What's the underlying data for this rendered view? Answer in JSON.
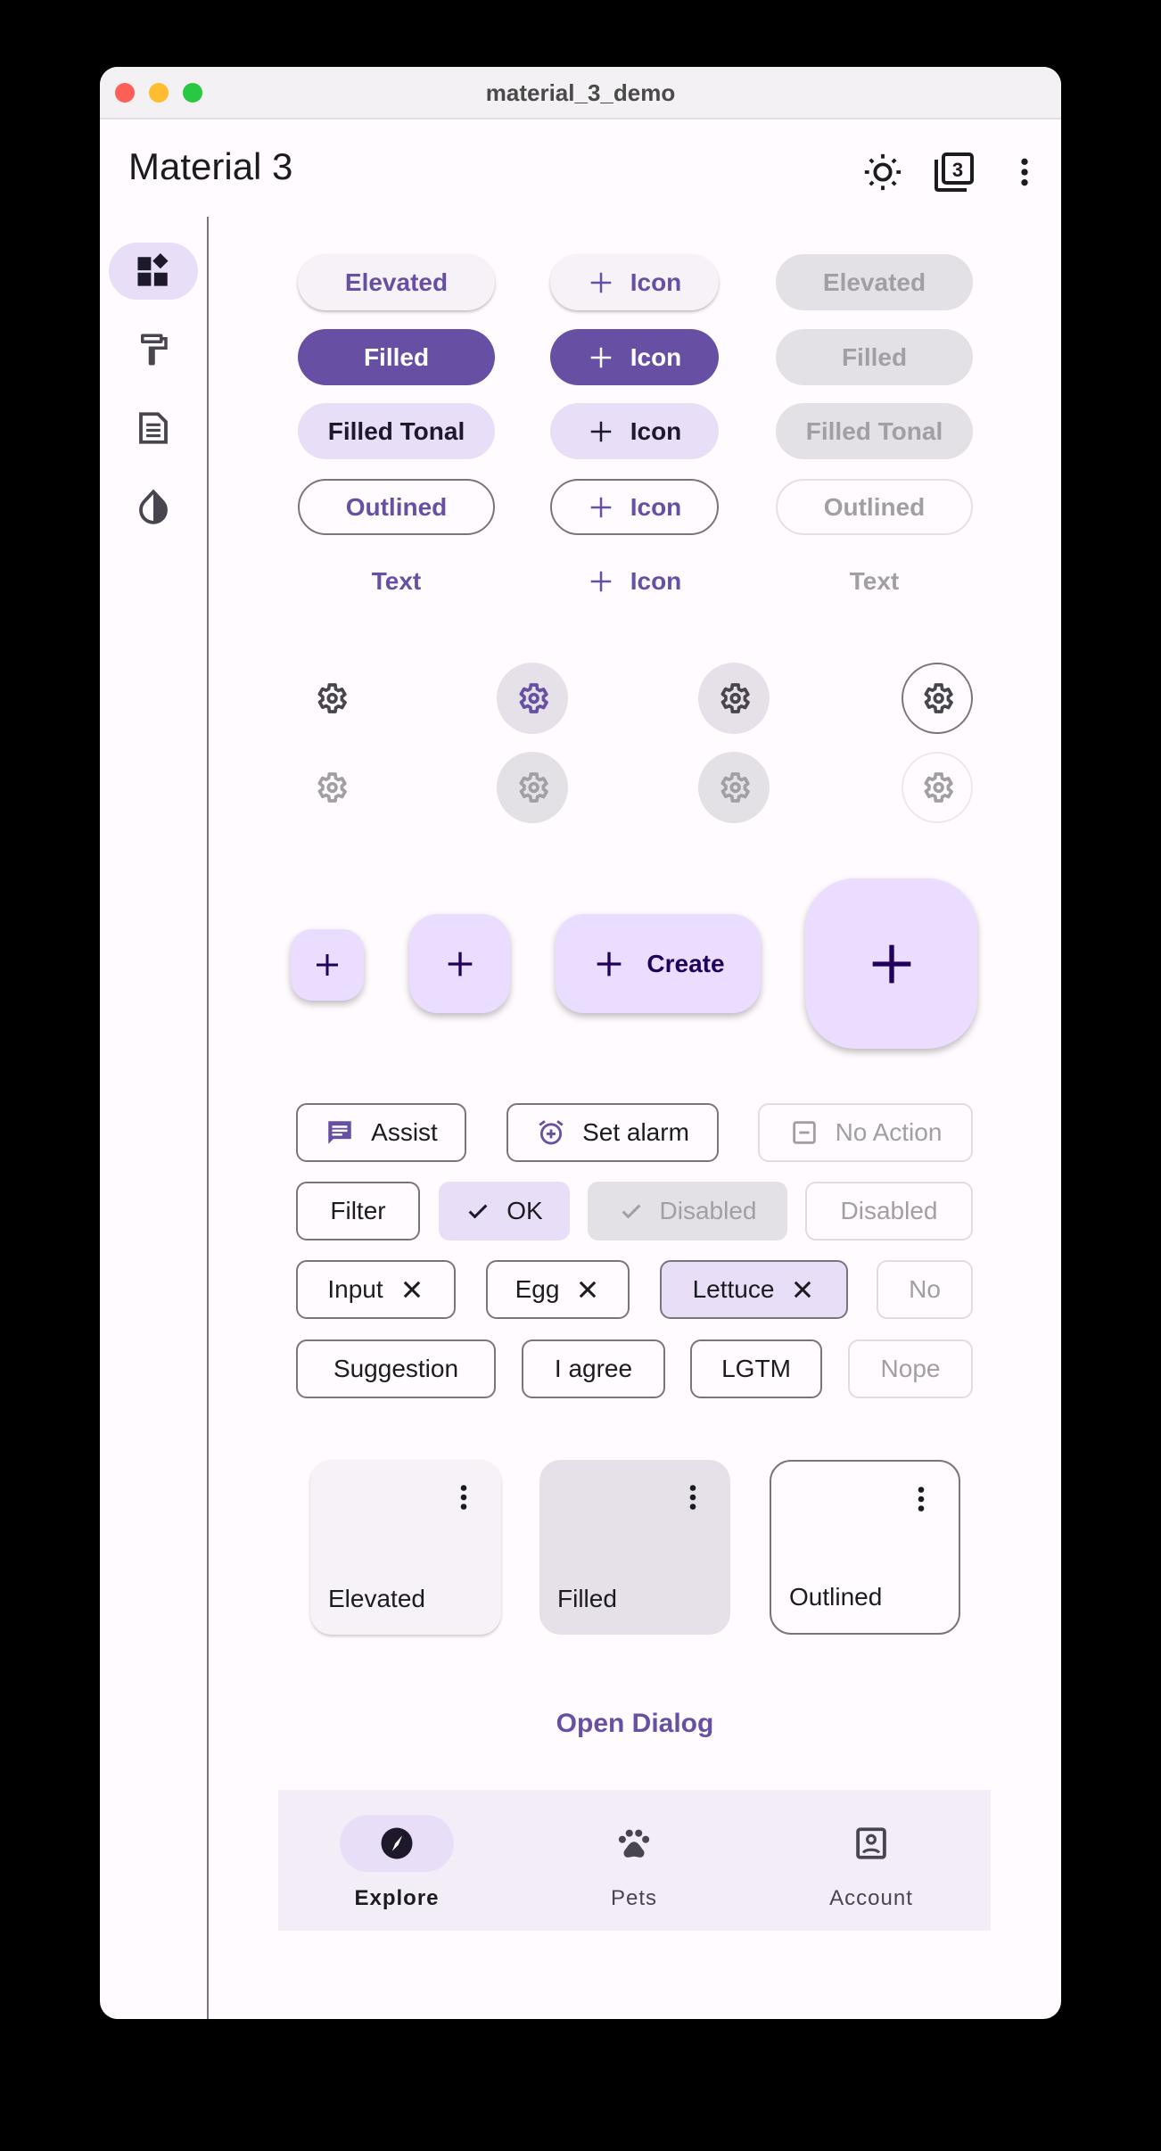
{
  "window": {
    "title": "material_3_demo"
  },
  "appbar": {
    "title": "Material 3",
    "actions": [
      {
        "icon": "brightness-icon",
        "name": "toggle-brightness"
      },
      {
        "icon": "filter-3-icon",
        "name": "material-version"
      },
      {
        "icon": "more-vert-icon",
        "name": "more-options"
      }
    ]
  },
  "rail": {
    "items": [
      {
        "icon": "widgets-icon",
        "name": "components",
        "selected": true
      },
      {
        "icon": "format-paint-icon",
        "name": "color",
        "selected": false
      },
      {
        "icon": "article-icon",
        "name": "typography",
        "selected": false
      },
      {
        "icon": "invert-colors-icon",
        "name": "elevation",
        "selected": false
      }
    ]
  },
  "buttons": {
    "enabled": [
      "Elevated",
      "Filled",
      "Filled Tonal",
      "Outlined",
      "Text"
    ],
    "icon_label": "Icon",
    "disabled": [
      "Elevated",
      "Filled",
      "Filled Tonal",
      "Outlined",
      "Text"
    ]
  },
  "icon_buttons": {
    "rows": [
      "enabled",
      "disabled"
    ],
    "styles": [
      "standard",
      "filled",
      "filled-tonal",
      "outlined"
    ],
    "icon": "settings-icon"
  },
  "fabs": {
    "extended_label": "Create",
    "sizes": [
      "small",
      "regular",
      "extended",
      "large"
    ]
  },
  "chips": {
    "assist": [
      "Assist",
      "Set alarm",
      "No Action"
    ],
    "filter": [
      "Filter",
      "OK",
      "Disabled",
      "Disabled"
    ],
    "input": [
      "Input",
      "Egg",
      "Lettuce",
      "No"
    ],
    "suggestion": [
      "Suggestion",
      "I agree",
      "LGTM",
      "Nope"
    ]
  },
  "cards": [
    "Elevated",
    "Filled",
    "Outlined"
  ],
  "dialog": {
    "open_label": "Open Dialog"
  },
  "bottom_nav": {
    "items": [
      {
        "label": "Explore",
        "icon": "explore-icon",
        "selected": true
      },
      {
        "label": "Pets",
        "icon": "pets-icon",
        "selected": false
      },
      {
        "label": "Account",
        "icon": "account-box-icon",
        "selected": false
      }
    ]
  },
  "colors": {
    "primary": "#6750a4",
    "secondary_container": "#e8def8",
    "surface": "#fffbfe",
    "outline": "#79747e"
  }
}
